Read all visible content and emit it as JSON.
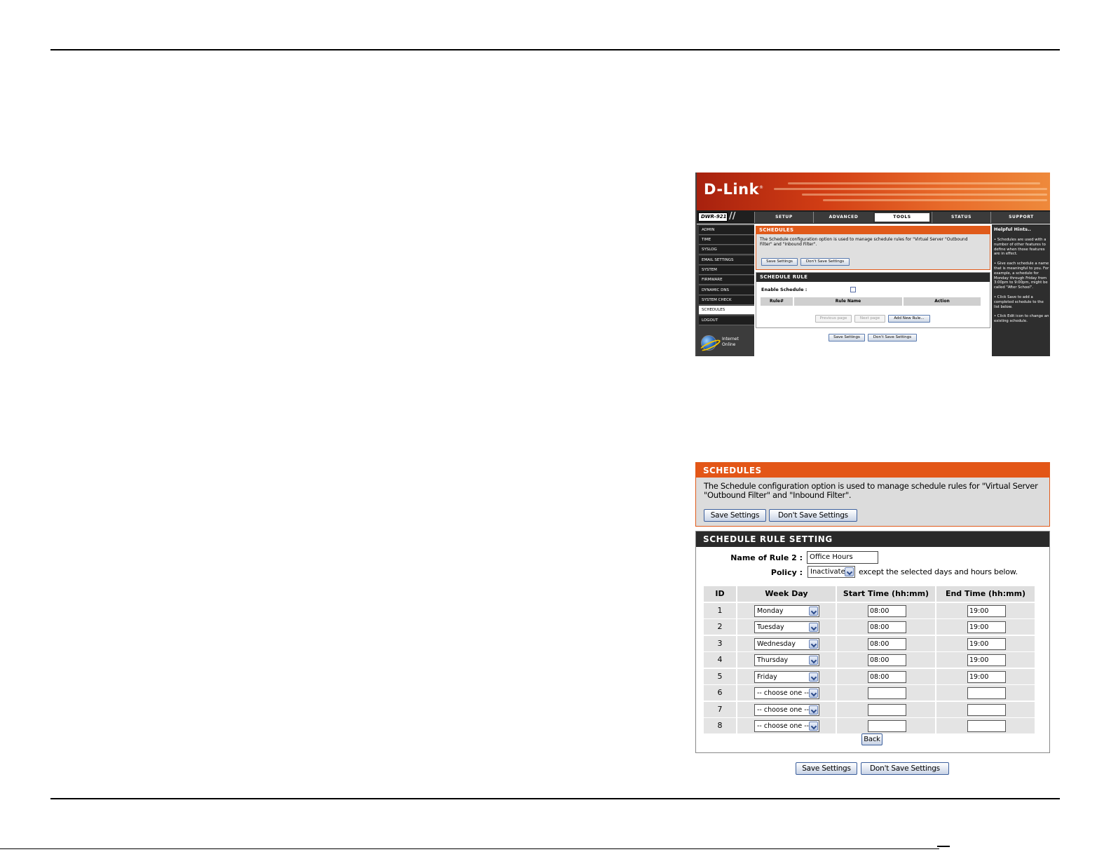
{
  "screenshot1": {
    "logo": "D-Link",
    "logo_mark": "®",
    "model": "DWR-921",
    "nav_tabs": [
      "SETUP",
      "ADVANCED",
      "TOOLS",
      "STATUS",
      "SUPPORT"
    ],
    "active_tab": "TOOLS",
    "sidebar": [
      "ADMIN",
      "TIME",
      "SYSLOG",
      "EMAIL SETTINGS",
      "SYSTEM",
      "FIRMWARE",
      "DYNAMIC DNS",
      "SYSTEM CHECK",
      "SCHEDULES",
      "LOGOUT"
    ],
    "active_sidebar": "SCHEDULES",
    "internet_status": "Internet Online",
    "schedules_title": "SCHEDULES",
    "schedules_desc": "The Schedule configuration option is used to manage schedule rules for \"Virtual Server \"Outbound Filter\" and \"Inbound Filter\".",
    "save_label": "Save Settings",
    "dont_save_label": "Don't Save Settings",
    "rule_title": "SCHEDULE RULE",
    "enable_label": "Enable Schedule :",
    "table_headers": [
      "Rule#",
      "Rule Name",
      "Action"
    ],
    "prev_page": "Previous page",
    "next_page": "Next page",
    "add_rule": "Add New Rule...",
    "hints_title": "Helpful Hints..",
    "hints": [
      "• Schedules are used with a number of other features to define when those features are in effect.",
      "• Give each schedule a name that is meaningful to you. For example, a schedule for Monday through Friday from 3:00pm to 9:00pm, might be called \"After School\".",
      "• Click Save to add a completed schedule to the list below.",
      "• Click Edit icon to change an existing schedule."
    ]
  },
  "screenshot2": {
    "schedules_title": "SCHEDULES",
    "schedules_desc": "The Schedule configuration option is used to manage schedule rules for \"Virtual Server \"Outbound Filter\" and \"Inbound Filter\".",
    "save_label": "Save Settings",
    "dont_save_label": "Don't Save Settings",
    "rule_setting_title": "SCHEDULE RULE SETTING",
    "name_label": "Name of Rule 2 :",
    "name_value": "Office Hours",
    "policy_label": "Policy :",
    "policy_value": "Inactivate",
    "policy_suffix": "except the selected days and hours below.",
    "table_headers": [
      "ID",
      "Week Day",
      "Start Time (hh:mm)",
      "End Time (hh:mm)"
    ],
    "rows": [
      {
        "id": "1",
        "day": "Monday",
        "start": "08:00",
        "end": "19:00"
      },
      {
        "id": "2",
        "day": "Tuesday",
        "start": "08:00",
        "end": "19:00"
      },
      {
        "id": "3",
        "day": "Wednesday",
        "start": "08:00",
        "end": "19:00"
      },
      {
        "id": "4",
        "day": "Thursday",
        "start": "08:00",
        "end": "19:00"
      },
      {
        "id": "5",
        "day": "Friday",
        "start": "08:00",
        "end": "19:00"
      },
      {
        "id": "6",
        "day": "-- choose one --",
        "start": "",
        "end": ""
      },
      {
        "id": "7",
        "day": "-- choose one --",
        "start": "",
        "end": ""
      },
      {
        "id": "8",
        "day": "-- choose one --",
        "start": "",
        "end": ""
      }
    ],
    "back_label": "Back"
  }
}
